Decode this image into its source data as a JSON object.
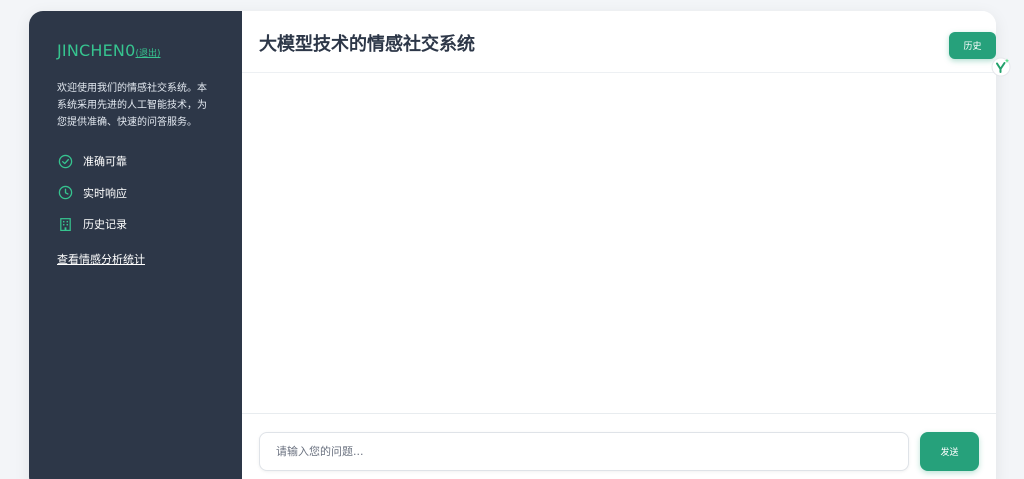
{
  "sidebar": {
    "brand_name": "JINCHEN0",
    "logout_label": "(退出)",
    "intro": "欢迎使用我们的情感社交系统。本系统采用先进的人工智能技术，为您提供准确、快速的问答服务。",
    "features": [
      {
        "label": "准确可靠",
        "icon": "check-circle-icon"
      },
      {
        "label": "实时响应",
        "icon": "clock-icon"
      },
      {
        "label": "历史记录",
        "icon": "building-icon"
      }
    ],
    "stats_link": "查看情感分析统计"
  },
  "header": {
    "title": "大模型技术的情感社交系统",
    "history_button": "历史"
  },
  "input": {
    "placeholder": "请输入您的问题...",
    "value": "",
    "send_button": "发送"
  },
  "colors": {
    "sidebar_bg": "#2d3748",
    "accent": "#26a17b",
    "brand": "#36c48f"
  }
}
